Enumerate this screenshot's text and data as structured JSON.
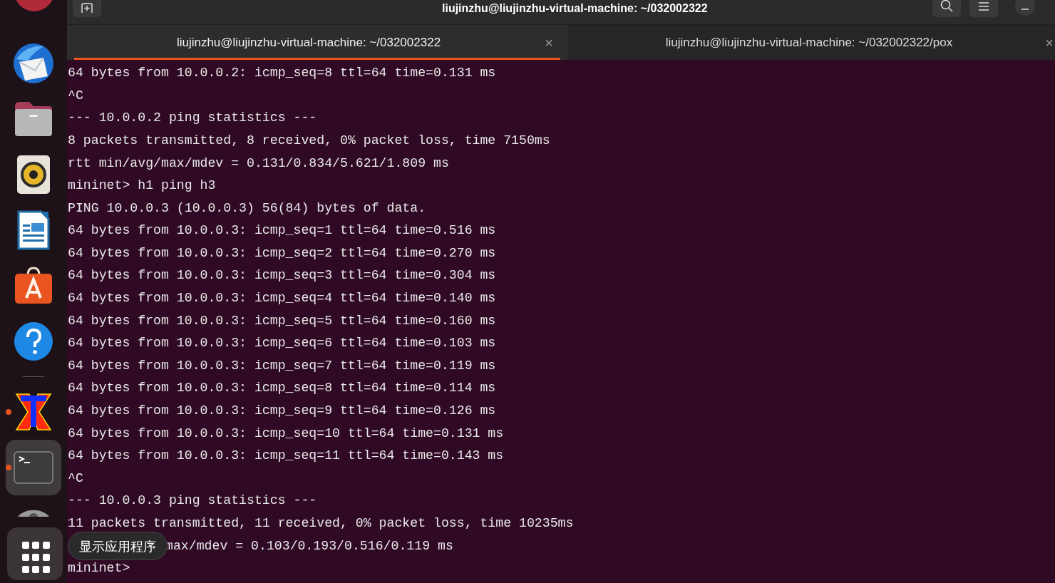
{
  "window": {
    "title": "liujinzhu@liujinzhu-virtual-machine: ~/032002322"
  },
  "tabs": [
    {
      "label": "liujinzhu@liujinzhu-virtual-machine: ~/032002322",
      "selected": true,
      "close": "×"
    },
    {
      "label": "liujinzhu@liujinzhu-virtual-machine: ~/032002322/pox",
      "selected": false,
      "close": "×"
    }
  ],
  "dock": {
    "items": [
      {
        "kind": "mail",
        "running": false
      },
      {
        "kind": "files",
        "running": false
      },
      {
        "kind": "music",
        "running": false
      },
      {
        "kind": "writer",
        "running": false
      },
      {
        "kind": "store",
        "running": false
      },
      {
        "kind": "help",
        "running": false
      },
      {
        "kind": "separator"
      },
      {
        "kind": "tex",
        "running": true
      },
      {
        "kind": "terminal",
        "running": true,
        "selected": true
      },
      {
        "kind": "disc",
        "running": false
      }
    ],
    "tooltip": "显示应用程序"
  },
  "terminal": {
    "lines": [
      {
        "text": "64 bytes from 10.0.0.2: icmp_seq=8 ttl=64 time=0.131 ms",
        "covered": false
      },
      {
        "text": "^C",
        "covered": false
      },
      {
        "text": "--- 10.0.0.2 ping statistics ---",
        "covered": false
      },
      {
        "text": "8 packets transmitted, 8 received, 0% packet loss, time 7150ms",
        "covered": false
      },
      {
        "text": "rtt min/avg/max/mdev = 0.131/0.834/5.621/1.809 ms",
        "covered": false
      },
      {
        "text": "mininet> h1 ping h3",
        "covered": false
      },
      {
        "text": "PING 10.0.0.3 (10.0.0.3) 56(84) bytes of data.",
        "covered": false
      },
      {
        "text": "64 bytes from 10.0.0.3: icmp_seq=1 ttl=64 time=0.516 ms",
        "covered": false
      },
      {
        "text": "64 bytes from 10.0.0.3: icmp_seq=2 ttl=64 time=0.270 ms",
        "covered": false
      },
      {
        "text": "64 bytes from 10.0.0.3: icmp_seq=3 ttl=64 time=0.304 ms",
        "covered": false
      },
      {
        "text": "64 bytes from 10.0.0.3: icmp_seq=4 ttl=64 time=0.140 ms",
        "covered": false
      },
      {
        "text": "64 bytes from 10.0.0.3: icmp_seq=5 ttl=64 time=0.160 ms",
        "covered": false
      },
      {
        "text": "64 bytes from 10.0.0.3: icmp_seq=6 ttl=64 time=0.103 ms",
        "covered": false
      },
      {
        "text": "64 bytes from 10.0.0.3: icmp_seq=7 ttl=64 time=0.119 ms",
        "covered": false
      },
      {
        "text": "64 bytes from 10.0.0.3: icmp_seq=8 ttl=64 time=0.114 ms",
        "covered": false
      },
      {
        "text": "64 bytes from 10.0.0.3: icmp_seq=9 ttl=64 time=0.126 ms",
        "covered": false
      },
      {
        "text": "64 bytes from 10.0.0.3: icmp_seq=10 ttl=64 time=0.131 ms",
        "covered": false
      },
      {
        "text": "64 bytes from 10.0.0.3: icmp_seq=11 ttl=64 time=0.143 ms",
        "covered": false
      },
      {
        "text": "^C",
        "covered": false
      },
      {
        "text": "--- 10.0.0.3 ping statistics ---",
        "covered": false
      },
      {
        "text": "11 packets transmitted, 11 received, 0% packet loss, time 10235ms",
        "covered": false
      },
      {
        "text": "max/mdev = 0.103/0.193/0.516/0.119 ms",
        "covered": true
      },
      {
        "text": "mininet>",
        "covered": false
      }
    ]
  }
}
